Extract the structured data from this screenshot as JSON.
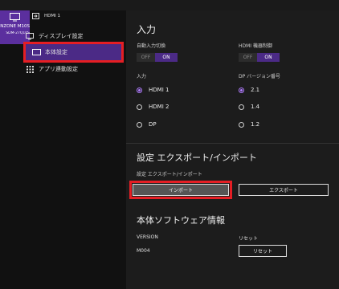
{
  "device": {
    "name": "NZONE M10S",
    "model": "SDM-27Q10S"
  },
  "header": {
    "input_label": "HDMI 1"
  },
  "sidebar": {
    "items": [
      {
        "label": "ディスプレイ設定"
      },
      {
        "label": "本体設定",
        "selected": true
      },
      {
        "label": "アプリ連動設定"
      }
    ]
  },
  "input_section": {
    "title": "入力",
    "auto_switch": {
      "label": "自動入力切換",
      "off": "OFF",
      "on": "ON",
      "value": "ON"
    },
    "hdmi_control": {
      "label": "HDMI 機器制御",
      "off": "OFF",
      "on": "ON",
      "value": "ON"
    },
    "input": {
      "label": "入力",
      "options": [
        "HDMI 1",
        "HDMI 2",
        "DP"
      ],
      "selected": "HDMI 1"
    },
    "dp_version": {
      "label": "DP バージョン番号",
      "options": [
        "2.1",
        "1.4",
        "1.2"
      ],
      "selected": "2.1"
    }
  },
  "export_section": {
    "title": "設定 エクスポート/インポート",
    "label": "設定 エクスポート/インポート",
    "import_button": "インポート",
    "export_button": "エクスポート"
  },
  "software_section": {
    "title": "本体ソフトウェア情報",
    "version_label": "VERSION",
    "version_value": "M004",
    "reset_label": "リセット",
    "reset_button": "リセット"
  },
  "colors": {
    "accent": "#4b2a86",
    "highlight": "#e51e24",
    "radio": "#b07cff"
  }
}
